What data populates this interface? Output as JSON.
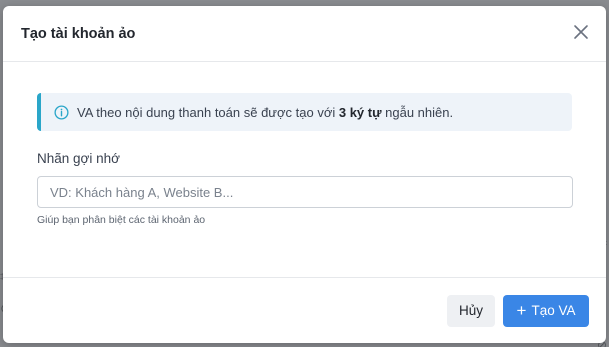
{
  "background": {
    "fragments": [
      "⌗",
      "⊘",
      "⌗",
      "⊘"
    ]
  },
  "modal": {
    "title": "Tạo tài khoản ảo",
    "close_icon": "close-icon"
  },
  "info": {
    "icon": "info-circle-icon",
    "text_before": "VA theo nội dung thanh toán sẽ được tạo với ",
    "text_strong": "3 ký tự",
    "text_after": " ngẫu nhiên."
  },
  "form": {
    "label": "Nhãn gợi nhớ",
    "value": "",
    "placeholder": "VD: Khách hàng A, Website B...",
    "help": "Giúp bạn phân biệt các tài khoản ảo"
  },
  "footer": {
    "cancel_label": "Hủy",
    "create_label": "Tạo VA",
    "create_icon": "plus-icon"
  },
  "colors": {
    "accent": "#3a86e6",
    "info_border": "#2aa6c9",
    "info_bg": "#eef3f9"
  }
}
